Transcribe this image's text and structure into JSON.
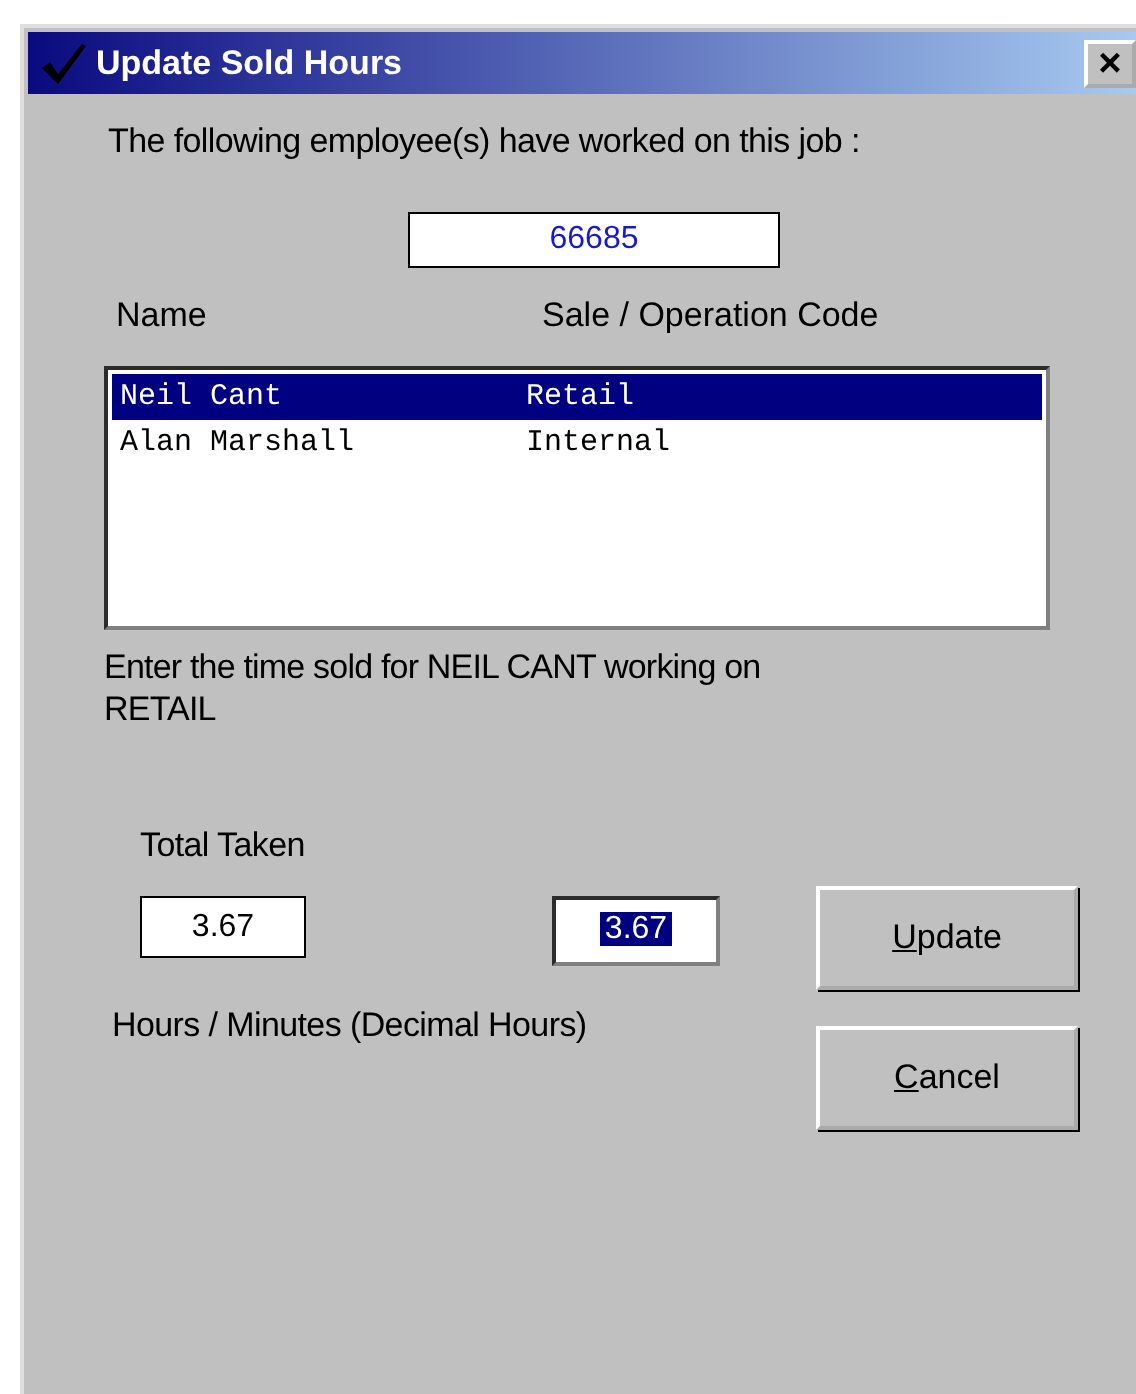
{
  "window": {
    "title": "Update Sold Hours",
    "close": "×"
  },
  "intro": "The following employee(s) have worked on this job :",
  "job_number": "66685",
  "columns": [
    "Name",
    "Sale / Operation Code"
  ],
  "employees": [
    {
      "name": "Neil Cant",
      "code": "Retail",
      "selected": true
    },
    {
      "name": "Alan Marshall",
      "code": "Internal",
      "selected": false
    }
  ],
  "prompt": "Enter the time sold for NEIL CANT working on RETAIL",
  "total_label": "Total Taken",
  "total_taken": "3.67",
  "time_sold": {
    "value": "3.67",
    "selected": true
  },
  "units_label": "Hours / Minutes (Decimal Hours)",
  "buttons": [
    "Update",
    "Cancel"
  ]
}
